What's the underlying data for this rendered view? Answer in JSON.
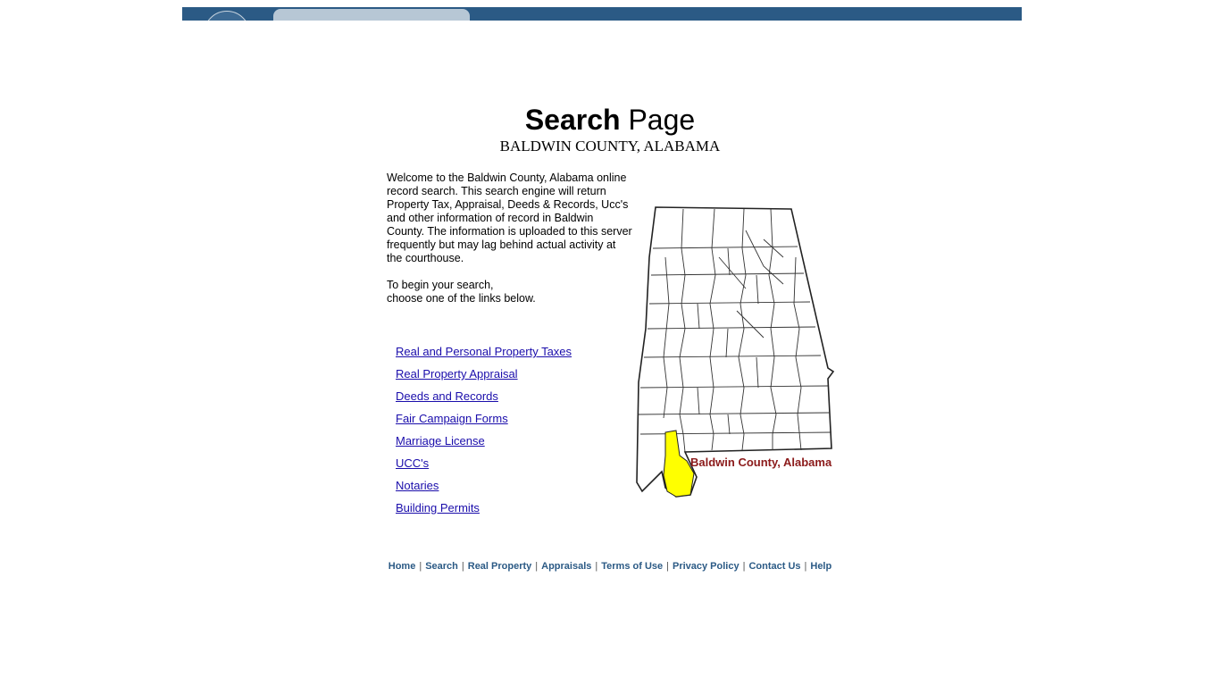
{
  "title": {
    "bold": "Search",
    "rest": " Page"
  },
  "subtitle": "BALDWIN COUNTY, ALABAMA",
  "intro": {
    "paragraph1": "Welcome to the Baldwin County, Alabama online record search. This search engine will return Property Tax, Appraisal, Deeds & Records, Ucc's and other information of record in Baldwin County. The information is uploaded to this server frequently but may lag behind actual activity at the courthouse.",
    "paragraph2_line1": "To begin your search,",
    "paragraph2_line2": "choose one of the links below."
  },
  "links": [
    "Real and Personal Property Taxes",
    "Real Property Appraisal",
    "Deeds and Records",
    "Fair Campaign Forms",
    "Marriage License",
    "UCC's",
    "Notaries",
    "Building Permits"
  ],
  "map": {
    "label": "Baldwin County, Alabama",
    "highlight_color": "#ffff00",
    "label_color": "#8b1a1a"
  },
  "footer": [
    "Home",
    "Search",
    "Real Property",
    "Appraisals",
    "Terms of Use",
    "Privacy Policy",
    "Contact Us",
    "Help"
  ],
  "footer_separator": "|",
  "colors": {
    "banner": "#2b5a85",
    "link": "#1a0dab",
    "footer_link": "#2b5a85"
  }
}
